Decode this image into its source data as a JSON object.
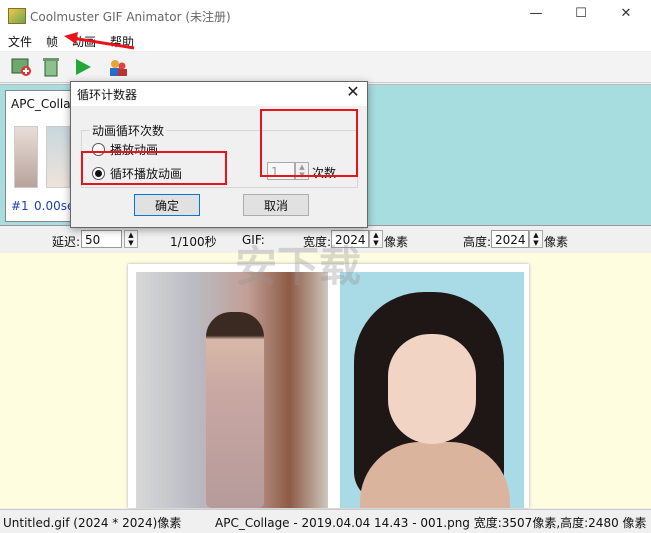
{
  "window": {
    "title": "Coolmuster GIF Animator  (未注册)",
    "minimize": "—",
    "maximize": "☐",
    "close": "✕"
  },
  "menu": {
    "items": [
      "文件",
      "帧",
      "动画",
      "帮助"
    ]
  },
  "toolbar": {
    "icons": [
      "add-frame-icon",
      "delete-frame-icon",
      "play-icon",
      "users-icon"
    ]
  },
  "frames": {
    "panel_label": "APC_Collage",
    "frame_index": "#1",
    "frame_time": "0.00se"
  },
  "controls": {
    "delay_label": "延迟:",
    "delay_value": "50",
    "unit": "1/100秒",
    "gif_label": "GIF:",
    "width_label": "宽度:",
    "width_value": "2024",
    "width_unit": "像素",
    "height_label": "高度:",
    "height_value": "2024",
    "height_unit": "像素"
  },
  "dialog": {
    "title": "循环计数器",
    "close": "✕",
    "group_title": "动画循环次数",
    "option_play": "播放动画",
    "option_loop": "循环播放动画",
    "selected": "循环播放动画",
    "count_value": "1",
    "count_label": "次数",
    "ok": "确定",
    "cancel": "取消"
  },
  "watermark": "安下载",
  "status": {
    "left": "Untitled.gif (2024 * 2024)像素",
    "right": "APC_Collage - 2019.04.04 14.43 - 001.png 宽度:3507像素,高度:2480 像素"
  },
  "colors": {
    "frames_bg": "#a8dde0",
    "preview_bg": "#fffde0",
    "highlight": "#e8141b"
  }
}
